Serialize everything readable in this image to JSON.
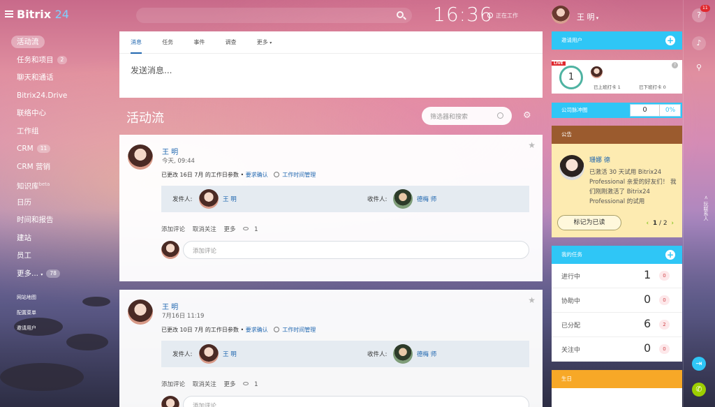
{
  "header": {
    "logo_text": "Bitrix",
    "logo_num": "24",
    "clock": "16:36",
    "work_status": "正在工作",
    "user_name": "王 明"
  },
  "nav": {
    "items": [
      {
        "label": "活动流",
        "badge": ""
      },
      {
        "label": "任务和项目",
        "badge": "2"
      },
      {
        "label": "聊天和通话",
        "badge": ""
      },
      {
        "label": "Bitrix24.Drive",
        "badge": ""
      },
      {
        "label": "联络中心",
        "badge": ""
      },
      {
        "label": "工作组",
        "badge": ""
      },
      {
        "label": "CRM",
        "badge": "11"
      },
      {
        "label": "CRM 营销",
        "badge": ""
      },
      {
        "label": "知识库",
        "badge": "",
        "sup": "beta"
      },
      {
        "label": "日历",
        "badge": ""
      },
      {
        "label": "时间和报告",
        "badge": ""
      },
      {
        "label": "建站",
        "badge": ""
      },
      {
        "label": "员工",
        "badge": ""
      },
      {
        "label": "更多...",
        "badge": "78"
      }
    ],
    "small_links": [
      "网站地图",
      "配置菜单",
      "邀请用户"
    ]
  },
  "composer": {
    "tabs": [
      "消息",
      "任务",
      "事件",
      "调查",
      "更多"
    ],
    "placeholder": "发送消息..."
  },
  "feed": {
    "title": "活动流",
    "filter_placeholder": "筛选器和搜索",
    "posts": [
      {
        "author": "王 明",
        "time": "今天, 09:44",
        "text": "已更改 16日 7月 的工作日参数 •",
        "link1": "要求确认",
        "link2": "工作时间管理",
        "sender_label": "发件人:",
        "sender": "王 明",
        "receiver_label": "收件人:",
        "receiver": "德梅 师",
        "actions": [
          "添加评论",
          "取消关注",
          "更多"
        ],
        "views": "1",
        "comment_placeholder": "添加评论"
      },
      {
        "author": "王 明",
        "time": "7月16日 11:19",
        "text": "已更改 10日 7月 的工作日参数 •",
        "link1": "要求确认",
        "link2": "工作时间管理",
        "sender_label": "发件人:",
        "sender": "王 明",
        "receiver_label": "收件人:",
        "receiver": "德梅 师",
        "actions": [
          "添加评论",
          "取消关注",
          "更多"
        ],
        "views": "1",
        "comment_placeholder": "添加评论"
      }
    ]
  },
  "right": {
    "invite_title": "邀请用户",
    "live": {
      "tag": "LIVE",
      "count": "1",
      "checked_in": "已上班打卡 1",
      "checked_out": "已下班打卡 0"
    },
    "pulse": {
      "title": "公司脉冲图",
      "value": "0",
      "percent": "0%"
    },
    "notice": {
      "title": "公告",
      "author": "珊娜 德",
      "text": "已激活 30 天试用 Bitrix24 Professional 亲爱的好友们！ 我们刚刚激活了 Bitrix24 Professional 的试用",
      "button": "标记为已读",
      "page_current": "1",
      "page_total": "2"
    },
    "tasks": {
      "title": "我的任务",
      "rows": [
        {
          "label": "进行中",
          "count": "1",
          "badge": "0"
        },
        {
          "label": "协助中",
          "count": "0",
          "badge": "0"
        },
        {
          "label": "已分配",
          "count": "6",
          "badge": "2"
        },
        {
          "label": "关注中",
          "count": "0",
          "badge": "0"
        }
      ]
    },
    "birthday_title": "生日"
  },
  "sidebar_right": {
    "help_badge": "11",
    "vertical_text": "< 玩联系人"
  }
}
